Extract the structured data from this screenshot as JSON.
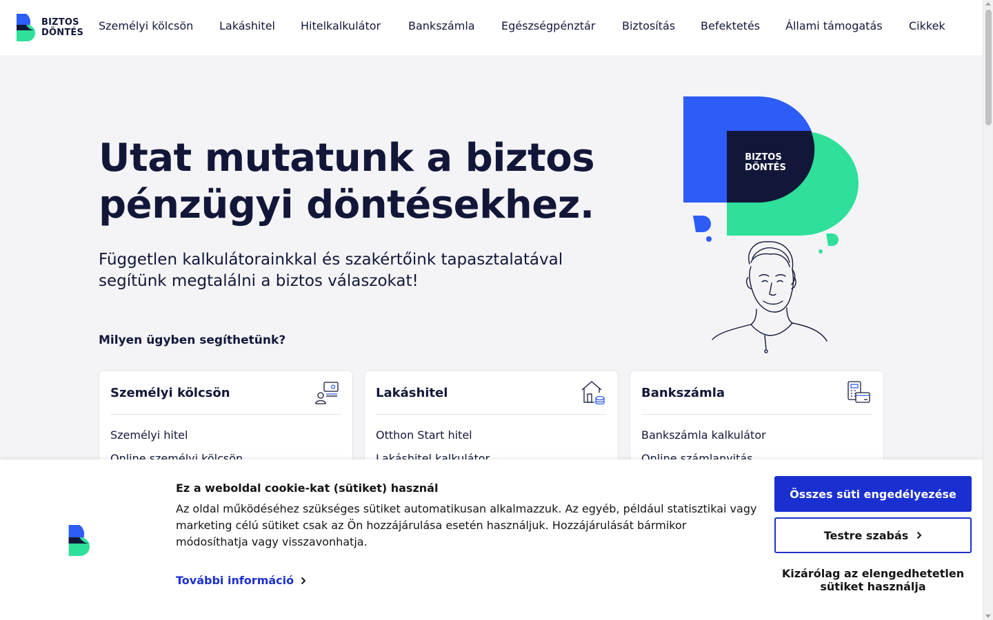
{
  "brand": {
    "line1": "BIZTOS",
    "line2": "DÖNTÉS",
    "blue": "#2d5cf6",
    "green": "#2ee09a",
    "navy": "#12173a"
  },
  "nav": [
    "Személyi kölcsön",
    "Lakáshitel",
    "Hitelkalkulátor",
    "Bankszámla",
    "Egészségpénztár",
    "Biztosítás",
    "Befektetés",
    "Állami támogatás",
    "Cikkek"
  ],
  "hero": {
    "title_line1": "Utat mutatunk a biztos",
    "title_line2": "pénzügyi döntésekhez.",
    "subtitle_line1": "Független kalkulátorainkkal és szakértőink tapasztalatával",
    "subtitle_line2": "segítünk megtalálni a biztos válaszokat!",
    "help_heading": "Milyen ügyben segíthetünk?",
    "illustration_badge_line1": "BIZTOS",
    "illustration_badge_line2": "DÖNTÉS"
  },
  "cards": [
    {
      "title": "Személyi kölcsön",
      "icon": "personal-loan-icon",
      "links": [
        "Személyi hitel",
        "Online személyi kölcsön"
      ]
    },
    {
      "title": "Lakáshitel",
      "icon": "house-coins-icon",
      "links": [
        "Otthon Start hitel",
        "Lakáshitel kalkulátor"
      ]
    },
    {
      "title": "Bankszámla",
      "icon": "bank-card-icon",
      "links": [
        "Bankszámla kalkulátor",
        "Online számlanyitás"
      ]
    }
  ],
  "cookie": {
    "title": "Ez a weboldal cookie-kat (sütiket) használ",
    "text": "Az oldal működéséhez szükséges sütiket automatikusan alkalmazzuk. Az egyéb, például statisztikai vagy marketing célú sütiket csak az Ön hozzájárulása esetén használjuk. Hozzájárulását bármikor módosíthatja vagy visszavonhatja.",
    "more_link": "További információ",
    "accept_all": "Összes süti engedélyezése",
    "customize": "Testre szabás",
    "necessary_only_line1": "Kizárólag az elengedhetetlen",
    "necessary_only_line2": "sütiket használja",
    "accent": "#1a2fd0"
  }
}
